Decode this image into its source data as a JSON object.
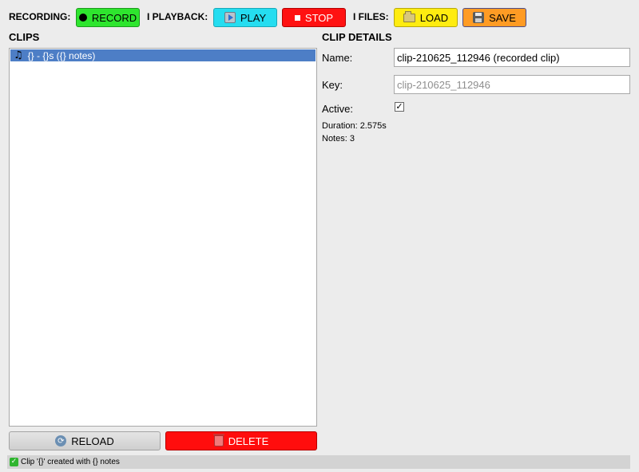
{
  "toolbar": {
    "recording_label": "RECORDING:",
    "record_button": "RECORD",
    "playback_label": "I PLAYBACK:",
    "play_button": "PLAY",
    "stop_button": "STOP",
    "files_label": "I FILES:",
    "load_button": "LOAD",
    "save_button": "SAVE"
  },
  "clips": {
    "title": "CLIPS",
    "items": [
      {
        "label": "{} - {}s ({} notes)",
        "selected": true
      }
    ],
    "reload_button": "RELOAD",
    "delete_button": "DELETE"
  },
  "details": {
    "title": "CLIP DETAILS",
    "name_label": "Name:",
    "name_value": "clip-210625_112946 (recorded clip)",
    "key_label": "Key:",
    "key_placeholder": "clip-210625_112946",
    "active_label": "Active:",
    "active_checked": true,
    "duration": "Duration: 2.575s",
    "notes": "Notes: 3"
  },
  "status": {
    "message": "Clip '{}' created with {} notes"
  },
  "colors": {
    "record": "#2ee52e",
    "play": "#25ddf0",
    "stop": "#ff1111",
    "load": "#ffec10",
    "save": "#ff9b24",
    "delete": "#ff0d0d",
    "selection": "#4d7ec6"
  }
}
